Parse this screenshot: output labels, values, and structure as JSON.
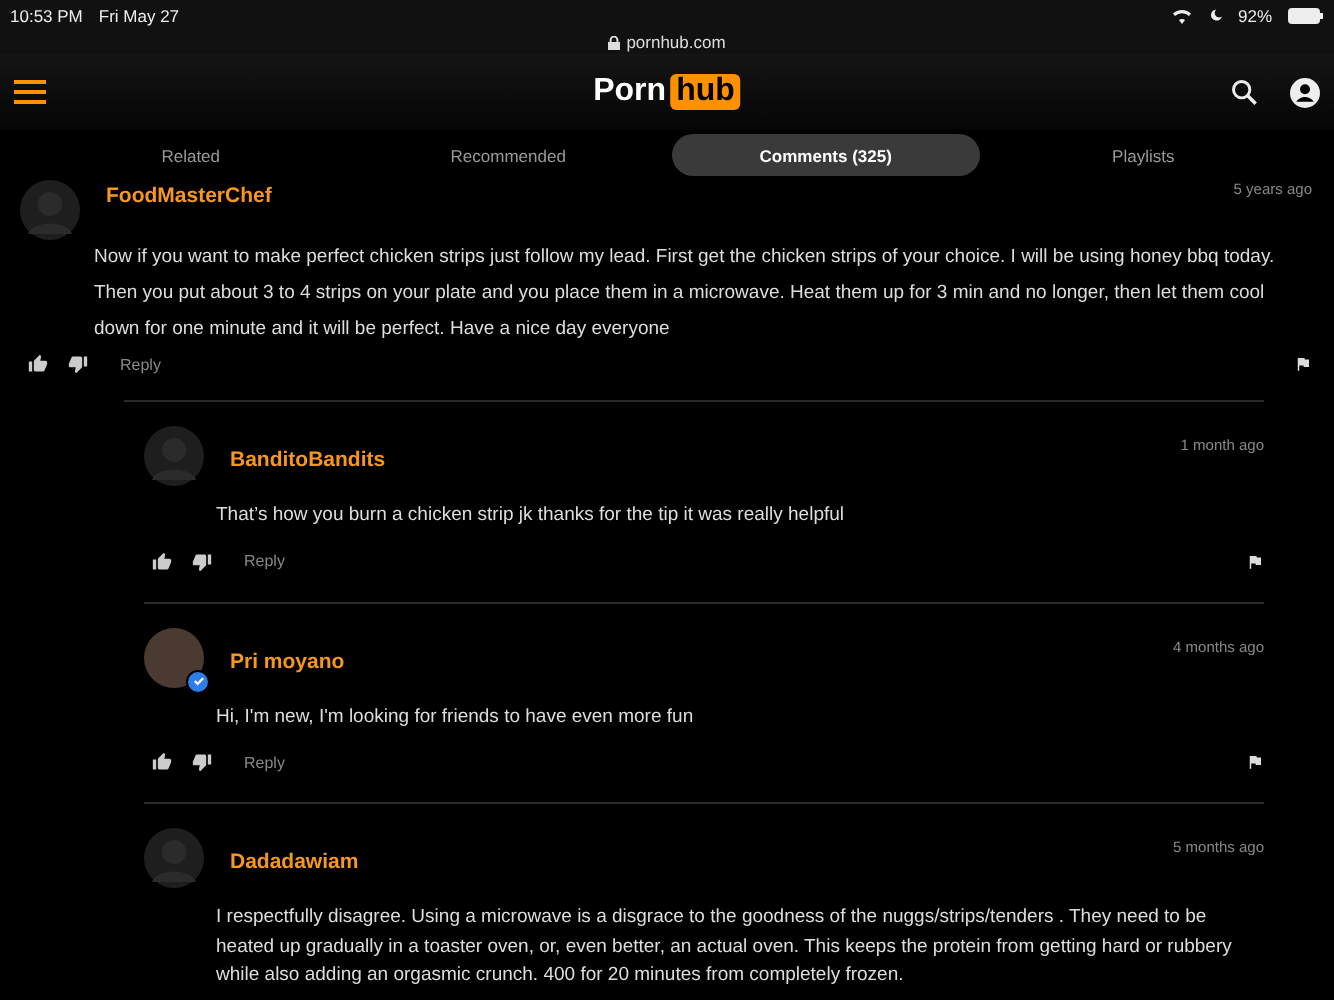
{
  "status_bar": {
    "time": "10:53 PM",
    "date": "Fri May 27",
    "battery": "92%"
  },
  "address_bar": {
    "url": "pornhub.com"
  },
  "header": {
    "logo_left": "Porn",
    "logo_right": "hub"
  },
  "tabs": [
    {
      "label": "Related",
      "selected": false
    },
    {
      "label": "Recommended",
      "selected": false
    },
    {
      "label": "Comments (325)",
      "selected": true
    },
    {
      "label": "Playlists",
      "selected": false
    }
  ],
  "comments": [
    {
      "author": "FoodMasterChef",
      "time": "5 years ago",
      "photo": false,
      "verified": false,
      "text": "Now if you want to make perfect chicken strips just follow my lead. First get the chicken strips of your choice. I will be using honey bbq today. Then you put about 3 to 4 strips on your plate and you place them in a microwave. Heat them up for 3 min and no longer, then let them cool down for one minute and it will be perfect. Have a nice day everyone",
      "reply_label": "Reply",
      "children": [
        {
          "author": "BanditoBandits",
          "time": "1 month ago",
          "photo": false,
          "verified": false,
          "text": "That’s how you burn a chicken strip jk thanks for the tip it was really helpful",
          "reply_label": "Reply"
        },
        {
          "author": "Pri moyano",
          "time": "4 months ago",
          "photo": true,
          "verified": true,
          "text": "Hi, I'm new, I'm looking for friends to have even more fun",
          "reply_label": "Reply"
        },
        {
          "author": "Dadadawiam",
          "time": "5 months ago",
          "photo": false,
          "verified": false,
          "text": "I respectfully disagree. Using a microwave is a disgrace to the goodness of the nuggs/strips/tenders . They need to be heated up gradually in a toaster oven, or, even better, an actual oven. This keeps the protein from getting hard or rubbery while also adding an orgasmic crunch. 400 for 20 minutes from completely frozen."
        }
      ]
    }
  ]
}
